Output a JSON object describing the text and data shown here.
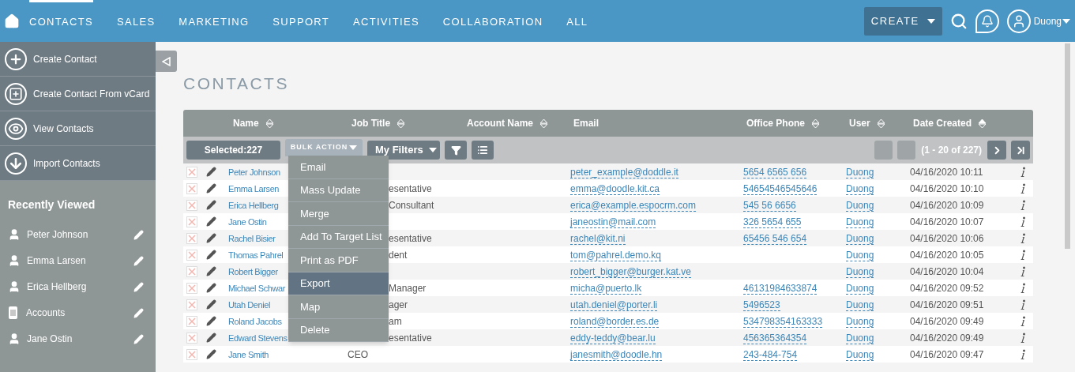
{
  "nav": {
    "tabs": [
      {
        "label": "CONTACTS",
        "selected": true
      },
      {
        "label": "SALES",
        "selected": false
      },
      {
        "label": "MARKETING",
        "selected": false
      },
      {
        "label": "SUPPORT",
        "selected": false
      },
      {
        "label": "ACTIVITIES",
        "selected": false
      },
      {
        "label": "COLLABORATION",
        "selected": false
      },
      {
        "label": "ALL",
        "selected": false
      }
    ],
    "create_button": "CREATE",
    "user": "Duong"
  },
  "sidebar": {
    "actions": [
      {
        "kind": "create",
        "label": "Create Contact"
      },
      {
        "kind": "vcard",
        "label": "Create Contact From vCard"
      },
      {
        "kind": "view",
        "label": "View Contacts"
      },
      {
        "kind": "import",
        "label": "Import Contacts"
      }
    ],
    "recently_viewed": {
      "title": "Recently Viewed",
      "items": [
        {
          "kind": "person",
          "label": "Peter Johnson"
        },
        {
          "kind": "person",
          "label": "Emma Larsen"
        },
        {
          "kind": "person",
          "label": "Erica Hellberg"
        },
        {
          "kind": "account",
          "label": "Accounts"
        },
        {
          "kind": "person",
          "label": "Jane Ostin"
        }
      ]
    }
  },
  "page_title": "CONTACTS",
  "table": {
    "columns": [
      {
        "label": "Name",
        "sortable": true,
        "sorted": false
      },
      {
        "label": "Job Title",
        "sortable": true,
        "sorted": false
      },
      {
        "label": "Account Name",
        "sortable": true,
        "sorted": false
      },
      {
        "label": "Email",
        "sortable": false
      },
      {
        "label": "Office Phone",
        "sortable": true,
        "sorted": false
      },
      {
        "label": "User",
        "sortable": true,
        "sorted": false
      },
      {
        "label": "Date Created",
        "sortable": true,
        "sorted": true
      }
    ],
    "selected_count": "Selected:227",
    "bulk_action": "BULK ACTION",
    "filters": "My Filters",
    "pagination": "(1 - 20 of 227)",
    "bulk_menu": [
      {
        "label": "Email",
        "selected": false
      },
      {
        "label": "Mass Update",
        "selected": false
      },
      {
        "label": "Merge",
        "selected": false
      },
      {
        "label": "Add To Target List",
        "selected": false
      },
      {
        "label": "Print as PDF",
        "selected": false
      },
      {
        "label": "Export",
        "selected": true
      },
      {
        "label": "Map",
        "selected": false
      },
      {
        "label": "Delete",
        "selected": false
      }
    ],
    "rows": [
      {
        "checked": false,
        "name": "Peter Johnson",
        "email": "peter_example@doddle.it",
        "phone": "5654 6565 656",
        "user": "Duong",
        "date": "04/16/2020 10:11"
      },
      {
        "checked": false,
        "name": "Emma Larsen",
        "job": "esentative",
        "job_clipped": true,
        "email": "emma@doodle.kit.ca",
        "phone": "54654546545646",
        "user": "Duong",
        "date": "04/16/2020 10:10"
      },
      {
        "checked": false,
        "name": "Erica Hellberg",
        "job": "Consultant",
        "job_clipped": true,
        "email": "erica@example.espocrm.com",
        "phone": "545 56 6656",
        "user": "Duong",
        "date": "04/16/2020 10:09"
      },
      {
        "checked": false,
        "name": "Jane Ostin",
        "email": "janeostin@mail.com",
        "phone": "326 5654 655",
        "user": "Duong",
        "date": "04/16/2020 10:07"
      },
      {
        "checked": false,
        "name": "Rachel Bisier",
        "job": "esentative",
        "job_clipped": true,
        "email": "rachel@kit.ni",
        "phone": "65456 546 654",
        "user": "Duong",
        "date": "04/16/2020 10:06"
      },
      {
        "checked": false,
        "name": "Thomas Pahrel",
        "job": "dent",
        "job_clipped": true,
        "email": "tom@pahrel.demo.kq",
        "user": "Duong",
        "date": "04/16/2020 10:05"
      },
      {
        "checked": false,
        "name": "Robert Bigger",
        "email": "robert_bigger@burger.kat.ve",
        "user": "Duong",
        "date": "04/16/2020 10:04"
      },
      {
        "checked": false,
        "name": "Michael Schwar",
        "job": "Manager",
        "job_clipped": true,
        "email": "micha@puerto.lk",
        "phone": "46131984633874",
        "user": "Duong",
        "date": "04/16/2020 09:52"
      },
      {
        "checked": false,
        "name": "Utah Deniel",
        "job": "ager",
        "job_clipped": true,
        "email": "utah.deniel@porter.li",
        "phone": "5496523",
        "user": "Duong",
        "date": "04/16/2020 09:51"
      },
      {
        "checked": false,
        "name": "Roland Jacobs",
        "job": "am",
        "job_clipped": true,
        "email": "roland@border.es.de",
        "phone": "534798354163333",
        "user": "Duong",
        "date": "04/16/2020 09:49"
      },
      {
        "checked": false,
        "name": "Edward Stevens",
        "job": "esentative",
        "job_clipped": true,
        "email": "eddy-teddy@bear.lu",
        "phone": "456365364354",
        "user": "Duong",
        "date": "04/16/2020 09:49"
      },
      {
        "checked": false,
        "name": "Jane Smith",
        "job": "CEO",
        "email": "janesmith@doodle.hn",
        "phone": "243-484-754",
        "user": "Duong",
        "date": "04/16/2020 09:47"
      }
    ]
  }
}
